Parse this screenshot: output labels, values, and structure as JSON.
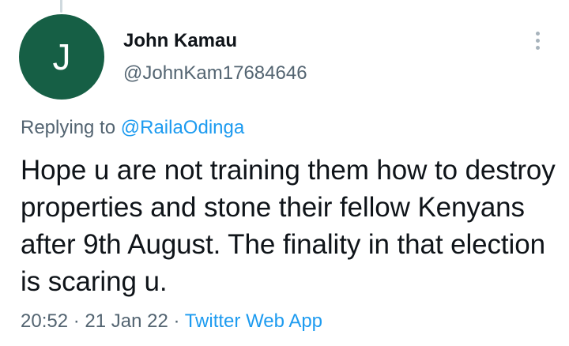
{
  "author": {
    "avatar_letter": "J",
    "avatar_color": "#165f45",
    "name": "John Kamau",
    "handle": "@JohnKam17684646"
  },
  "reply": {
    "prefix": "Replying to ",
    "mention": "@RailaOdinga"
  },
  "tweet": {
    "text": "Hope u are not training them how to destroy properties and stone their fellow Kenyans after 9th August. The finality in that election is scaring u."
  },
  "meta": {
    "time": "20:52",
    "separator": " · ",
    "date": "21 Jan 22",
    "source": "Twitter Web App"
  },
  "colors": {
    "accent": "#1d9bf0",
    "secondary_text": "#536471",
    "primary_text": "#0f1419"
  },
  "icons": {
    "more": "more-options-vertical-dots-icon"
  }
}
